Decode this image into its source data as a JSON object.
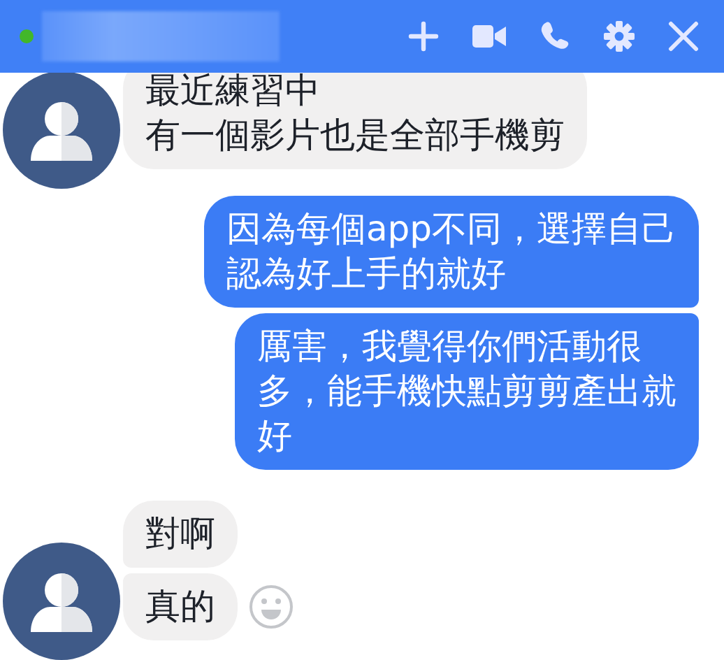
{
  "header": {
    "online": true,
    "actions": [
      {
        "kind": "add"
      },
      {
        "kind": "video"
      },
      {
        "kind": "call"
      },
      {
        "kind": "settings"
      },
      {
        "kind": "close"
      }
    ]
  },
  "groups": [
    {
      "kind": "incoming",
      "bubbles": [
        {
          "lines": [
            "最近練習中",
            "有一個影片也是全部手機剪"
          ],
          "react_icon": false
        }
      ]
    },
    {
      "kind": "outgoing",
      "bubbles": [
        {
          "lines": [
            "因為每個app不同，選擇自己",
            "認為好上手的就好"
          ],
          "react_icon": false
        },
        {
          "lines": [
            "厲害，我覺得你們活動很",
            "多，能手機快點剪剪產出就",
            "好"
          ],
          "react_icon": false
        }
      ]
    },
    {
      "kind": "incoming",
      "bubbles": [
        {
          "lines": [
            "對啊"
          ],
          "react_icon": false
        },
        {
          "lines": [
            "真的"
          ],
          "react_icon": true
        }
      ]
    }
  ]
}
